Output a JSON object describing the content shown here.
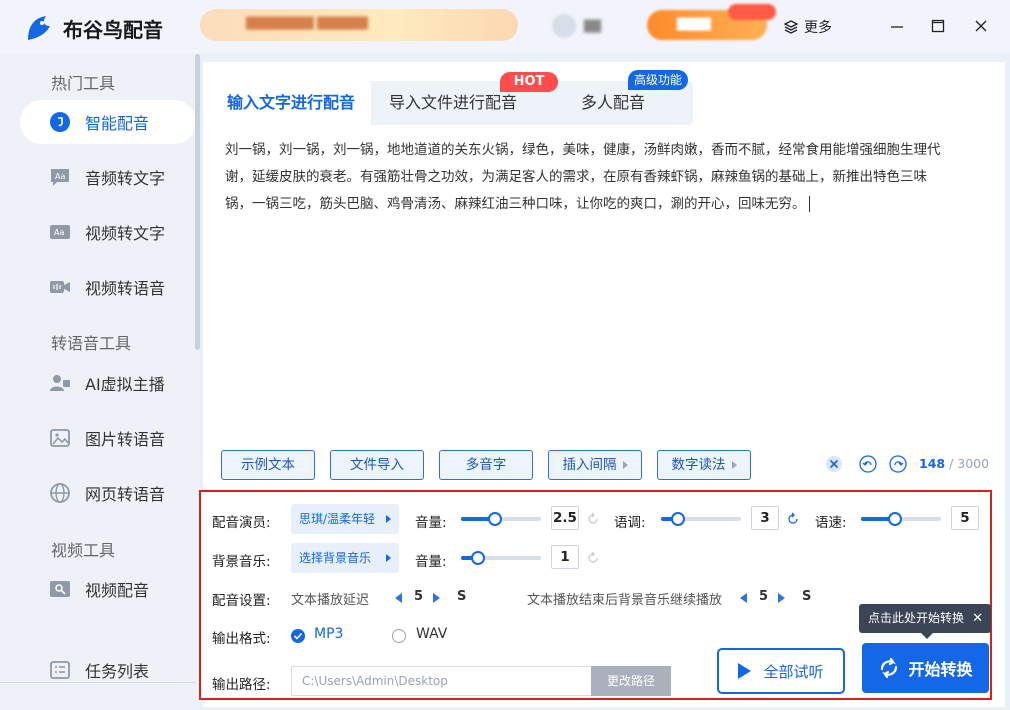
{
  "app": {
    "title": "布谷鸟配音",
    "more": "更多"
  },
  "sidebar": {
    "sections": [
      "热门工具",
      "转语音工具",
      "视频工具"
    ],
    "items": [
      {
        "label": "智能配音",
        "icon": "smart-dub-icon",
        "active": true
      },
      {
        "label": "音频转文字",
        "icon": "audio-to-text-icon"
      },
      {
        "label": "视频转文字",
        "icon": "video-to-text-icon"
      },
      {
        "label": "视频转语音",
        "icon": "video-to-voice-icon"
      },
      {
        "label": "AI虚拟主播",
        "icon": "ai-anchor-icon"
      },
      {
        "label": "图片转语音",
        "icon": "image-to-voice-icon"
      },
      {
        "label": "网页转语音",
        "icon": "web-to-voice-icon"
      },
      {
        "label": "视频配音",
        "icon": "video-dub-icon"
      }
    ],
    "task_list": "任务列表"
  },
  "tabs": [
    {
      "label": "输入文字进行配音",
      "active": true
    },
    {
      "label": "导入文件进行配音",
      "badge": "HOT"
    },
    {
      "label": "多人配音",
      "badge": "高级功能"
    }
  ],
  "text": {
    "lines": [
      "刘一锅，刘一锅，刘一锅，地地道道的关东火锅，绿色，美味，健康，汤鲜肉嫩，香而不腻，经常食用能增强细胞生理代",
      "谢，延缓皮肤的衰老。有强筋壮骨之功效，为满足客人的需求，在原有香辣虾锅，麻辣鱼锅的基础上，新推出特色三味",
      "锅，一锅三吃，筋头巴脑、鸡骨清汤、麻辣红油三种口味，让你吃的爽口，涮的开心，回味无穷。"
    ]
  },
  "toolbar": {
    "buttons": [
      "示例文本",
      "文件导入",
      "多音字",
      "插入间隔",
      "数字读法"
    ],
    "count": "148",
    "max": "/ 3000"
  },
  "settings": {
    "voice_label": "配音演员:",
    "voice_value": "思琪/温柔年轻",
    "volume_label": "音量:",
    "volume_value": "2.5",
    "pitch_label": "语调:",
    "pitch_value": "3",
    "speed_label": "语速:",
    "speed_value": "5",
    "bgm_label": "背景音乐:",
    "bgm_value": "选择背景音乐",
    "bgm_volume_label": "音量:",
    "bgm_volume_value": "1",
    "config_label": "配音设置:",
    "delay_label": "文本播放延迟",
    "delay_value": "5",
    "delay_unit": "S",
    "continue_label": "文本播放结束后背景音乐继续播放",
    "continue_value": "5",
    "continue_unit": "S",
    "format_label": "输出格式:",
    "format_options": [
      "MP3",
      "WAV"
    ],
    "format_selected": "MP3",
    "path_label": "输出路径:",
    "path_value": "C:\\Users\\Admin\\Desktop",
    "change_path": "更改路径",
    "listen_all": "全部试听",
    "start": "开始转换",
    "tooltip": "点击此处开始转换"
  },
  "colors": {
    "accent": "#1467e6",
    "hot": "#ff4d4f",
    "highlight_border": "#d4221f"
  }
}
